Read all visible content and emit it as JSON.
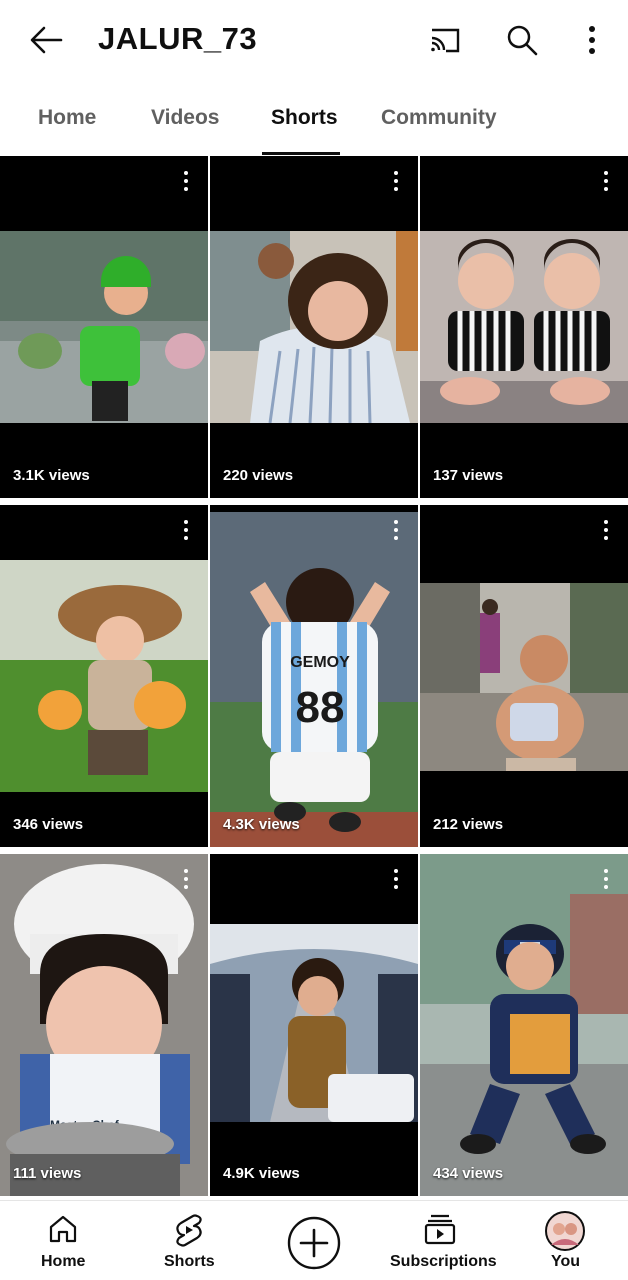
{
  "appbar": {
    "title": "JALUR_73",
    "back_icon": "arrow-left-icon",
    "cast_icon": "cast-icon",
    "search_icon": "search-icon",
    "more_icon": "more-vert-icon"
  },
  "tabs": [
    {
      "label": "Home",
      "active": false
    },
    {
      "label": "Videos",
      "active": false
    },
    {
      "label": "Shorts",
      "active": true
    },
    {
      "label": "Community",
      "active": false
    }
  ],
  "shorts": [
    {
      "views": "3.1K views",
      "scene": "Baby in green helmet riding green scooter in rain"
    },
    {
      "views": "220 views",
      "scene": "Crying baby getting a haircut"
    },
    {
      "views": "137 views",
      "scene": "Two babies in Juventus jerseys"
    },
    {
      "views": "346 views",
      "scene": "Baby in straw hat holding golden fish in rice field"
    },
    {
      "views": "4.3K views",
      "scene": "Baby in Argentina jersey GEMOY 88 cheering"
    },
    {
      "views": "212 views",
      "scene": "Surprised baby running with container"
    },
    {
      "views": "111 views",
      "scene": "Baby chef in white hat with pan"
    },
    {
      "views": "4.9K views",
      "scene": "Baby with suitcase in airplane aisle"
    },
    {
      "views": "434 views",
      "scene": "Baby ninja in blue and orange outfit"
    }
  ],
  "bottom_nav": [
    {
      "label": "Home",
      "icon": "home-icon"
    },
    {
      "label": "Shorts",
      "icon": "shorts-icon"
    },
    {
      "label": "",
      "icon": "create-plus-icon"
    },
    {
      "label": "Subscriptions",
      "icon": "subscriptions-icon"
    },
    {
      "label": "You",
      "icon": "avatar"
    }
  ],
  "colors": {
    "text_primary": "#0f0f0f",
    "text_secondary": "#606060",
    "tile_bg": "#000000"
  }
}
